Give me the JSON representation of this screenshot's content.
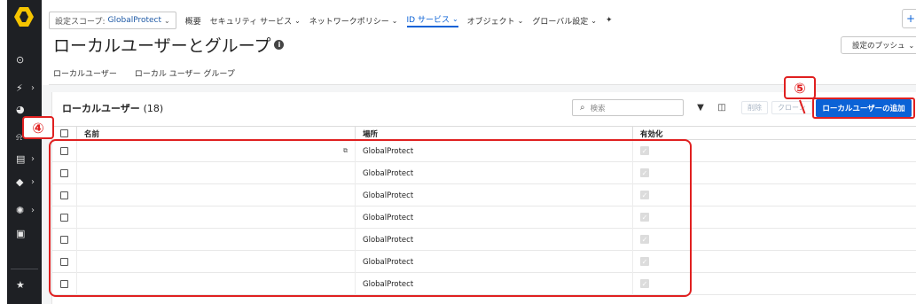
{
  "topnav": {
    "scope_label": "設定スコープ:",
    "scope_value": "GlobalProtect",
    "items": [
      {
        "label": "概要"
      },
      {
        "label": "セキュリティ サービス"
      },
      {
        "label": "ネットワークポリシー"
      },
      {
        "label": "ID サービス",
        "active": true
      },
      {
        "label": "オブジェクト"
      },
      {
        "label": "グローバル設定"
      }
    ]
  },
  "page": {
    "title": "ローカルユーザーとグループ",
    "push_button": "設定のプッシュ"
  },
  "tabs": [
    {
      "label": "ローカルユーザー",
      "active": true
    },
    {
      "label": "ローカル ユーザー グループ",
      "active": false
    }
  ],
  "panel": {
    "title": "ローカルユーザー",
    "count": "(18)",
    "search_placeholder": "検索",
    "delete_label": "削除",
    "clone_label": "クローン",
    "add_label": "ローカルユーザーの追加"
  },
  "table": {
    "columns": [
      "名前",
      "場所",
      "有効化"
    ],
    "rows": [
      {
        "name": "",
        "location": "GlobalProtect",
        "enabled": true
      },
      {
        "name": "",
        "location": "GlobalProtect",
        "enabled": true
      },
      {
        "name": "",
        "location": "GlobalProtect",
        "enabled": true
      },
      {
        "name": "",
        "location": "GlobalProtect",
        "enabled": true
      },
      {
        "name": "",
        "location": "GlobalProtect",
        "enabled": true
      },
      {
        "name": "",
        "location": "GlobalProtect",
        "enabled": true
      },
      {
        "name": "",
        "location": "GlobalProtect",
        "enabled": true
      }
    ]
  },
  "callouts": {
    "four": "④",
    "five": "⑤"
  },
  "colors": {
    "accent": "#0b62d6",
    "annotation": "#e02020",
    "sidebar": "#1e2024",
    "logo": "#f5c400"
  }
}
